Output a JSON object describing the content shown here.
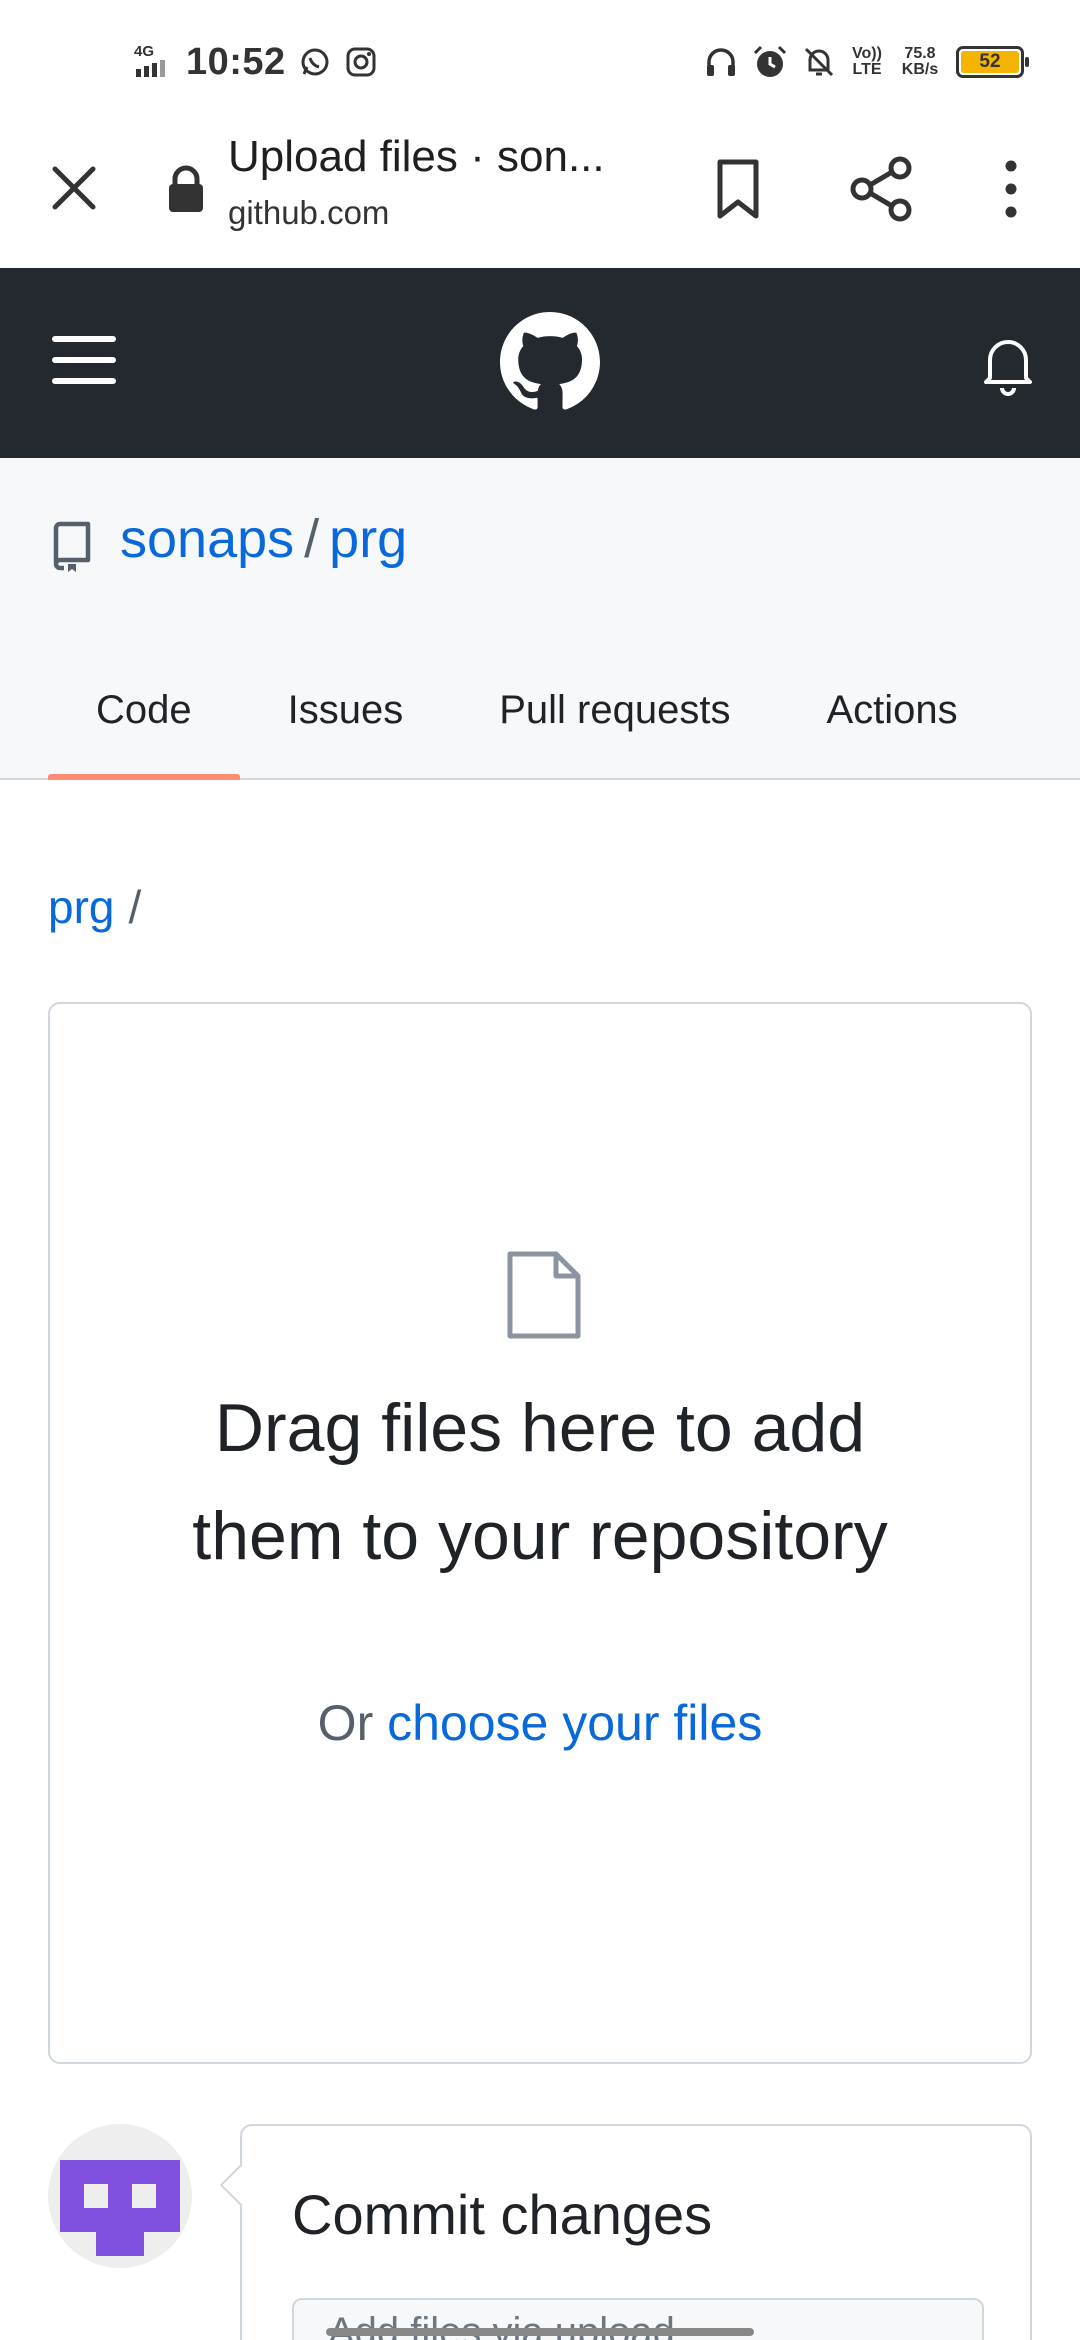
{
  "status_bar": {
    "network": "4G",
    "time": "10:52",
    "volte": "Vo)) LTE",
    "speed": "75.8 KB/s",
    "battery": "52",
    "icons": [
      "whatsapp-icon",
      "instagram-icon",
      "headphones-icon",
      "alarm-icon",
      "notifications-off-icon"
    ]
  },
  "browser": {
    "title": "Upload files · son...",
    "url": "github.com"
  },
  "repo": {
    "owner": "sonaps",
    "separator": "/",
    "name": "prg",
    "tabs": [
      {
        "label": "Code",
        "active": true
      },
      {
        "label": "Issues",
        "active": false
      },
      {
        "label": "Pull requests",
        "active": false
      },
      {
        "label": "Actions",
        "active": false
      }
    ]
  },
  "breadcrumb": {
    "repo": "prg",
    "slash": "/"
  },
  "dropzone": {
    "title": "Drag files here to add them to your repository",
    "sub_prefix": "Or",
    "sub_link": "choose your files"
  },
  "commit": {
    "title": "Commit changes",
    "input_placeholder": "Add files via upload"
  },
  "colors": {
    "header_bg": "#24292f",
    "link": "#0969da",
    "active_tab": "#fd8c73",
    "avatar": "#8250df"
  }
}
